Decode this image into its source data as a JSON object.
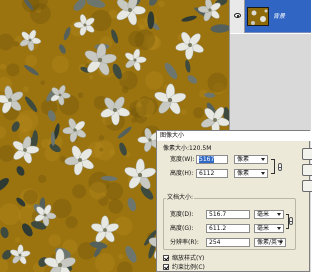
{
  "layers": {
    "layer_name": "背景"
  },
  "dialog": {
    "title": "图像大小",
    "pixel_dimensions": {
      "label": "像素大小:120.5M",
      "width_label": "宽度(W):",
      "width_value": "5167",
      "width_unit": "像素",
      "height_label": "高度(H):",
      "height_value": "6112",
      "height_unit": "像素"
    },
    "document_size": {
      "label": "文档大小:",
      "width_label": "宽度(D):",
      "width_value": "516.7",
      "width_unit": "毫米",
      "height_label": "高度(G):",
      "height_value": "611.2",
      "height_unit": "毫米",
      "resolution_label": "分辨率(R):",
      "resolution_value": "254",
      "resolution_unit": "像素/英寸"
    },
    "options": {
      "scale_styles": "缩放样式(Y)",
      "constrain_proportions": "约束比例(C)"
    }
  },
  "colors": {
    "canvas_background": "#9b7410",
    "selection_blue": "#3165c4",
    "dialog_background": "#ece9d8"
  },
  "icons": {
    "visibility": "eye-icon",
    "link": "chain-link-icon"
  }
}
